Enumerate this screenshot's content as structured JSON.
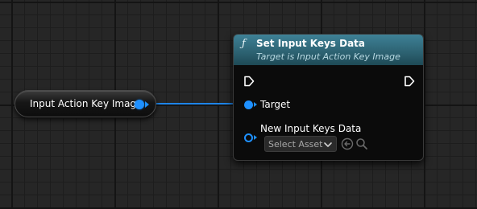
{
  "graph": {
    "variable_node": {
      "label": "Input Action Key Image"
    },
    "function_node": {
      "icon": "function-icon",
      "icon_glyph": "ƒ",
      "title": "Set Input Keys Data",
      "subtitle": "Target is Input Action Key Image",
      "pins": {
        "target_label": "Target",
        "input_keys_label": "New Input Keys Data",
        "asset_picker_value": "Select Asset"
      }
    }
  },
  "colors": {
    "object_pin": "#1e90ff",
    "function_header": "#2e6474",
    "exec_pin": "#ffffff"
  }
}
